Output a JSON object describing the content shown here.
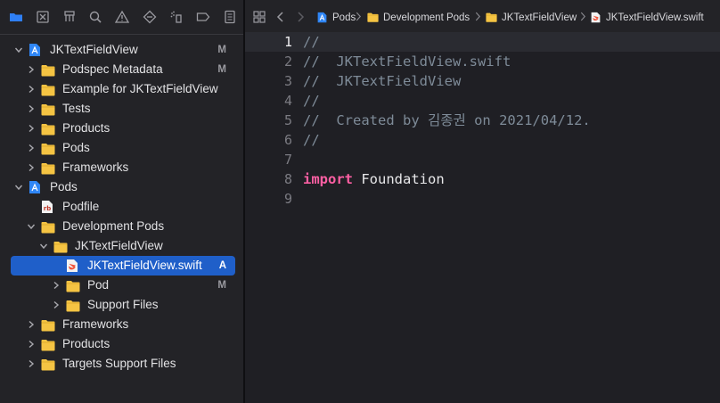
{
  "navigator": {
    "toolbar_icons": [
      "folder-icon",
      "source-control-icon",
      "symbol-hierarchy-icon",
      "find-icon",
      "issue-warning-icon",
      "test-diamond-icon",
      "debug-spray-icon",
      "breakpoint-icon",
      "report-icon"
    ],
    "tree": [
      {
        "label": "JKTextFieldView",
        "status": "M",
        "icon": "xcode-project-icon",
        "expanded": true
      },
      {
        "label": "Podspec Metadata",
        "status": "M",
        "icon": "folder-icon",
        "expanded": false
      },
      {
        "label": "Example for JKTextFieldView",
        "status": "",
        "icon": "folder-icon",
        "expanded": false
      },
      {
        "label": "Tests",
        "status": "",
        "icon": "folder-icon",
        "expanded": false
      },
      {
        "label": "Products",
        "status": "",
        "icon": "folder-icon",
        "expanded": false
      },
      {
        "label": "Pods",
        "status": "",
        "icon": "folder-icon",
        "expanded": false
      },
      {
        "label": "Frameworks",
        "status": "",
        "icon": "folder-icon",
        "expanded": false
      },
      {
        "label": "Pods",
        "status": "",
        "icon": "xcode-project-icon",
        "expanded": true
      },
      {
        "label": "Podfile",
        "status": "",
        "icon": "ruby-file-icon",
        "expanded": null
      },
      {
        "label": "Development Pods",
        "status": "",
        "icon": "folder-icon",
        "expanded": true
      },
      {
        "label": "JKTextFieldView",
        "status": "",
        "icon": "folder-icon",
        "expanded": true
      },
      {
        "label": "JKTextFieldView.swift",
        "status": "A",
        "icon": "swift-file-icon",
        "expanded": null,
        "selected": true
      },
      {
        "label": "Pod",
        "status": "M",
        "icon": "folder-icon",
        "expanded": false
      },
      {
        "label": "Support Files",
        "status": "",
        "icon": "folder-icon",
        "expanded": false
      },
      {
        "label": "Frameworks",
        "status": "",
        "icon": "folder-icon",
        "expanded": false
      },
      {
        "label": "Products",
        "status": "",
        "icon": "folder-icon",
        "expanded": false
      },
      {
        "label": "Targets Support Files",
        "status": "",
        "icon": "folder-icon",
        "expanded": false
      }
    ]
  },
  "jumpbar": {
    "crumbs": [
      {
        "label": "Pods",
        "icon": "xcode-project-icon"
      },
      {
        "label": "Development Pods",
        "icon": "folder-icon"
      },
      {
        "label": "JKTextFieldView",
        "icon": "folder-icon"
      },
      {
        "label": "JKTextFieldView.swift",
        "icon": "swift-file-icon"
      }
    ]
  },
  "editor": {
    "current_line": 1,
    "lines": [
      {
        "n": "1",
        "parts": [
          {
            "t": "//",
            "c": "comment"
          }
        ]
      },
      {
        "n": "2",
        "parts": [
          {
            "t": "//  JKTextFieldView.swift",
            "c": "comment"
          }
        ]
      },
      {
        "n": "3",
        "parts": [
          {
            "t": "//  JKTextFieldView",
            "c": "comment"
          }
        ]
      },
      {
        "n": "4",
        "parts": [
          {
            "t": "//",
            "c": "comment"
          }
        ]
      },
      {
        "n": "5",
        "parts": [
          {
            "t": "//  Created by 김종권 on 2021/04/12.",
            "c": "comment"
          }
        ]
      },
      {
        "n": "6",
        "parts": [
          {
            "t": "//",
            "c": "comment"
          }
        ]
      },
      {
        "n": "7",
        "parts": []
      },
      {
        "n": "8",
        "parts": [
          {
            "t": "import",
            "c": "kw"
          },
          {
            "t": " Foundation",
            "c": "plain"
          }
        ]
      },
      {
        "n": "9",
        "parts": []
      }
    ]
  },
  "colors": {
    "selection": "#1f5fc9",
    "folder": "#f5c443",
    "keyword": "#fc5fa3",
    "comment": "#7e8b98"
  }
}
